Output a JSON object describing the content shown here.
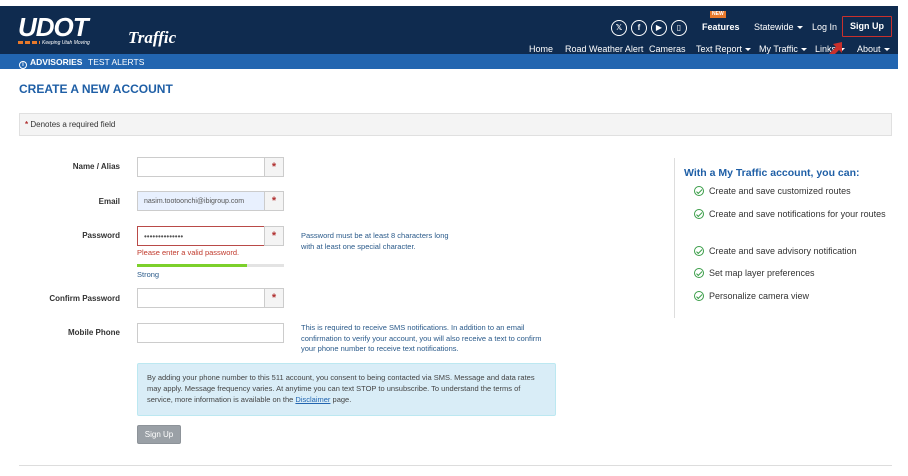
{
  "header": {
    "logo_text": "UDOT",
    "logo_tagline": "Keeping Utah Moving",
    "logo_product": "Traffic",
    "social": [
      {
        "icon": "x-icon",
        "glyph": "𝕏"
      },
      {
        "icon": "facebook-icon",
        "glyph": "f"
      },
      {
        "icon": "youtube-icon",
        "glyph": "▶"
      },
      {
        "icon": "mobile-app-icon",
        "glyph": "▯"
      }
    ],
    "features_badge": "NEW",
    "features_label": "Features",
    "region_label": "Statewide",
    "login_label": "Log In",
    "signup_label": "Sign Up",
    "nav": [
      {
        "label": "Home",
        "dropdown": false
      },
      {
        "label": "Road Weather Alert",
        "dropdown": false
      },
      {
        "label": "Cameras",
        "dropdown": false
      },
      {
        "label": "Text Report",
        "dropdown": true
      },
      {
        "label": "My Traffic",
        "dropdown": true
      },
      {
        "label": "Links",
        "dropdown": true
      },
      {
        "label": "About",
        "dropdown": true
      }
    ]
  },
  "advisory_bar": {
    "advisories_label": "ADVISORIES",
    "test_alerts_label": "TEST ALERTS"
  },
  "page": {
    "title": "CREATE A NEW ACCOUNT",
    "required_note": "Denotes a required field"
  },
  "form": {
    "name": {
      "label": "Name / Alias",
      "value": ""
    },
    "email": {
      "label": "Email",
      "value": "nasim.tootoonchi@ibigroup.com"
    },
    "password": {
      "label": "Password",
      "value": "••••••••••••••",
      "hint": "Password must be at least 8 characters long with at least one special character.",
      "error": "Please enter a valid password.",
      "strength_label": "Strong",
      "strength_fraction": 0.75
    },
    "confirm_password": {
      "label": "Confirm Password",
      "value": ""
    },
    "mobile_phone": {
      "label": "Mobile Phone",
      "value": "",
      "hint": "This is required to receive SMS notifications. In addition to an email confirmation to verify your account, you will also receive a text to confirm your phone number to receive text notifications."
    },
    "consent_text": "By adding your phone number to this 511 account, you consent to being contacted via SMS. Message and data rates may apply. Message frequency varies. At anytime you can text STOP to unsubscribe. To understand the terms of service, more information is available on the",
    "consent_link": "Disclaimer",
    "consent_suffix": "page.",
    "submit_label": "Sign Up",
    "required_marker": "*"
  },
  "benefits": {
    "title": "With a My Traffic account, you can:",
    "items": [
      "Create and save customized routes",
      "Create and save notifications for your routes",
      "Create and save advisory notification",
      "Set map layer preferences",
      "Personalize camera view"
    ]
  },
  "colors": {
    "header_bg": "#0f2b4f",
    "advisory_bg": "#2265b0",
    "title_blue": "#1f5fa6",
    "required_red": "#b03030",
    "strength_green": "#7cd02b",
    "check_green": "#3a9d48"
  }
}
